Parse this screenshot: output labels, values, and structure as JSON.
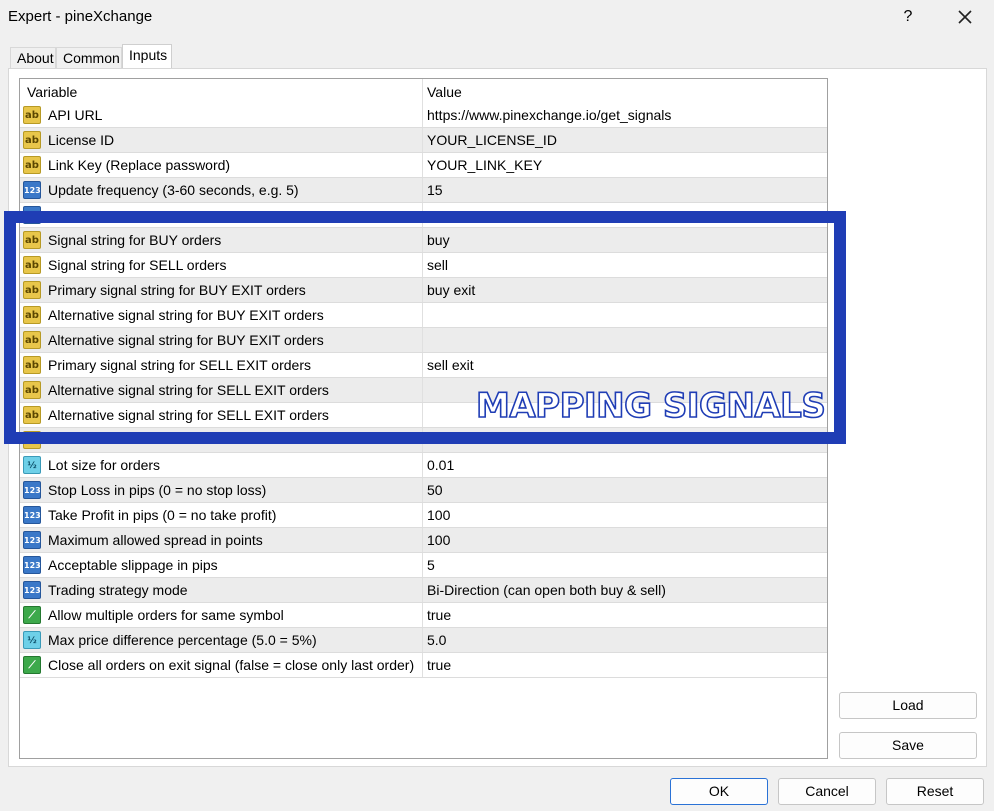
{
  "window": {
    "title": "Expert - pineXchange",
    "help_label": "?",
    "close_label": "✕"
  },
  "tabs": [
    {
      "label": "About",
      "active": false
    },
    {
      "label": "Common",
      "active": false
    },
    {
      "label": "Inputs",
      "active": true
    }
  ],
  "grid": {
    "columns": [
      "Variable",
      "Value"
    ],
    "rows": [
      {
        "icon": "string-icon",
        "variable": "API URL",
        "value": "https://www.pinexchange.io/get_signals"
      },
      {
        "icon": "string-icon",
        "variable": "License ID",
        "value": "YOUR_LICENSE_ID"
      },
      {
        "icon": "string-icon",
        "variable": "Link Key (Replace password)",
        "value": "YOUR_LINK_KEY"
      },
      {
        "icon": "integer-icon",
        "variable": "Update frequency (3-60 seconds, e.g. 5)",
        "value": "15"
      },
      {
        "icon": "integer-icon",
        "variable": "",
        "value": ""
      },
      {
        "icon": "string-icon",
        "variable": "Signal string for BUY orders",
        "value": "buy"
      },
      {
        "icon": "string-icon",
        "variable": "Signal string for SELL orders",
        "value": "sell"
      },
      {
        "icon": "string-icon",
        "variable": "Primary signal string for BUY EXIT orders",
        "value": "buy exit"
      },
      {
        "icon": "string-icon",
        "variable": "Alternative signal string for BUY EXIT orders",
        "value": ""
      },
      {
        "icon": "string-icon",
        "variable": "Alternative signal string for BUY EXIT orders",
        "value": ""
      },
      {
        "icon": "string-icon",
        "variable": "Primary signal string for SELL EXIT orders",
        "value": "sell exit"
      },
      {
        "icon": "string-icon",
        "variable": "Alternative signal string for SELL EXIT orders",
        "value": ""
      },
      {
        "icon": "string-icon",
        "variable": "Alternative signal string for SELL EXIT orders",
        "value": ""
      },
      {
        "icon": "string-icon",
        "variable": "",
        "value": ""
      },
      {
        "icon": "double-icon",
        "variable": "Lot size for orders",
        "value": "0.01"
      },
      {
        "icon": "integer-icon",
        "variable": "Stop Loss in pips (0 = no stop loss)",
        "value": "50"
      },
      {
        "icon": "integer-icon",
        "variable": "Take Profit in pips (0 = no take profit)",
        "value": "100"
      },
      {
        "icon": "integer-icon",
        "variable": "Maximum allowed spread in points",
        "value": "100"
      },
      {
        "icon": "integer-icon",
        "variable": "Acceptable slippage in pips",
        "value": "5"
      },
      {
        "icon": "integer-icon",
        "variable": "Trading strategy mode",
        "value": "Bi-Direction (can open both buy & sell)"
      },
      {
        "icon": "bool-icon",
        "variable": "Allow multiple orders for same symbol",
        "value": "true"
      },
      {
        "icon": "double-icon",
        "variable": "Max price difference percentage (5.0 = 5%)",
        "value": "5.0"
      },
      {
        "icon": "bool-icon",
        "variable": "Close all orders on exit signal (false = close only last order)",
        "value": "true"
      }
    ]
  },
  "overlay": {
    "label": "MAPPING SIGNALS",
    "color": "#1f3db5"
  },
  "side_buttons": {
    "load_label": "Load",
    "save_label": "Save"
  },
  "footer_buttons": {
    "ok_label": "OK",
    "cancel_label": "Cancel",
    "reset_label": "Reset"
  }
}
